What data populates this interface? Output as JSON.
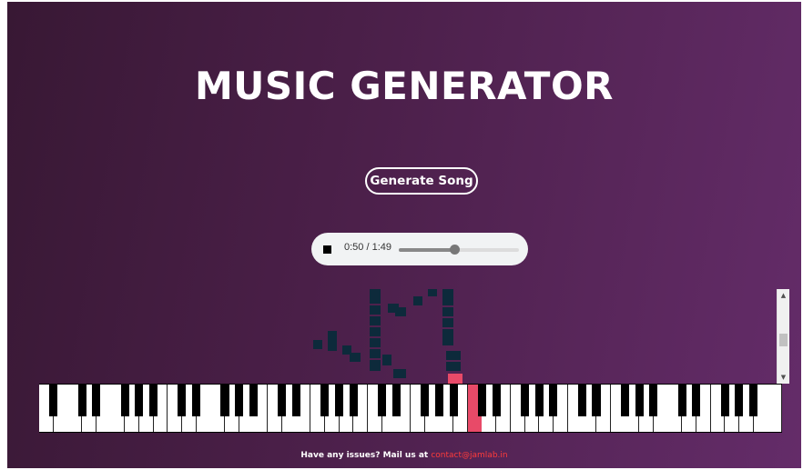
{
  "header": {
    "title": "MUSIC GENERATOR"
  },
  "actions": {
    "generate_label": "Generate Song"
  },
  "player": {
    "current_time": "0:50",
    "duration": "1:49",
    "time_display": "0:50 / 1:49",
    "progress_fraction": 0.46
  },
  "keyboard": {
    "white_key_count": 52,
    "active_white_key_index": 30,
    "active_color": "#e84a68"
  },
  "footer": {
    "text": "Have any issues? Mail us at",
    "email": "contact@jamlab.in"
  },
  "colors": {
    "background_start": "#381834",
    "background_end": "#642c69",
    "note_block": "#0d2a3b",
    "accent": "#e84a68",
    "link": "#ff3b3b"
  },
  "icons": {
    "stop": "stop-icon",
    "scroll_up": "scroll-up-arrow-icon",
    "scroll_down": "scroll-down-arrow-icon"
  }
}
